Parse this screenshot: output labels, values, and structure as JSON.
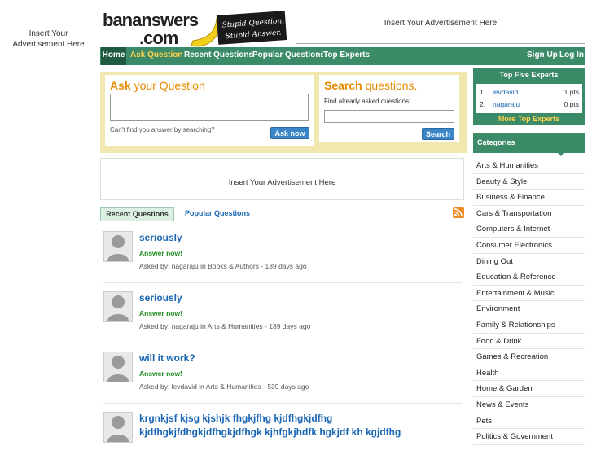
{
  "left_ad": {
    "line1": "Insert Your",
    "line2": "Advertisement Here"
  },
  "logo": {
    "wordmark1": "bananswers",
    "wordmark2": ".com",
    "tagline1": "Stupid Question.",
    "tagline2": "Stupid Answer."
  },
  "top_ad": "Insert Your Advertisement Here",
  "nav": {
    "home": "Home",
    "ask": "Ask Question",
    "recent": "Recent Questions",
    "popular": "Popular Questions",
    "experts": "Top Experts",
    "signup": "Sign Up",
    "login": "Log In"
  },
  "ask": {
    "title_bold": "Ask",
    "title_rest": " your Question",
    "hint": "Can't find you answer by searching?",
    "button": "Ask now"
  },
  "search": {
    "title_bold": "Search",
    "title_rest": " questions.",
    "subtitle": "Find already asked questions!",
    "button": "Search"
  },
  "mid_ad": "Insert Your Advertisement Here",
  "tabs": {
    "recent": "Recent Questions",
    "popular": "Popular Questions"
  },
  "questions": [
    {
      "title": "seriously",
      "answer": "Answer now!",
      "asked_by": "Asked by: ",
      "user": "nagaraju",
      "in": " in ",
      "category": "Books & Authors",
      "age": " - 189 days ago"
    },
    {
      "title": "seriously",
      "answer": "Answer now!",
      "asked_by": "Asked by: ",
      "user": "nagaraju",
      "in": " in ",
      "category": "Arts & Humanities",
      "age": " - 189 days ago"
    },
    {
      "title": "will it work?",
      "answer": "Answer now!",
      "asked_by": "Asked by: ",
      "user": "levdavid",
      "in": " in ",
      "category": "Arts & Humanities",
      "age": " - 539 days ago"
    },
    {
      "title": "krgnkjsf kjsg kjshjk fhgkjfhg kjdfhgkjdfhg kjdfhgkjfdhgkjdfhgkjdfhgk kjhfgkjhdfk hgkjdf kh kgjdfhg"
    }
  ],
  "top_experts": {
    "header": "Top Five Experts",
    "rows": [
      {
        "rank": "1.",
        "user": "levdavid",
        "pts": "1 pts"
      },
      {
        "rank": "2.",
        "user": "nagaraju",
        "pts": "0 pts"
      }
    ],
    "more": "More Top Experts"
  },
  "categories": {
    "header": "Categories",
    "items": [
      "Arts & Humanities",
      "Beauty & Style",
      "Business & Finance",
      "Cars & Transportation",
      "Computers & Internet",
      "Consumer Electronics",
      "Dining Out",
      "Education & Reference",
      "Entertainment & Music",
      "Environment",
      "Family & Relationships",
      "Food & Drink",
      "Games & Recreation",
      "Health",
      "Home & Garden",
      "News & Events",
      "Pets",
      "Politics & Government"
    ]
  },
  "colors": {
    "nav_green": "#3b8a68",
    "accent_orange": "#e68a00",
    "link_blue": "#1a66b3",
    "answer_green": "#1e8a1e"
  }
}
